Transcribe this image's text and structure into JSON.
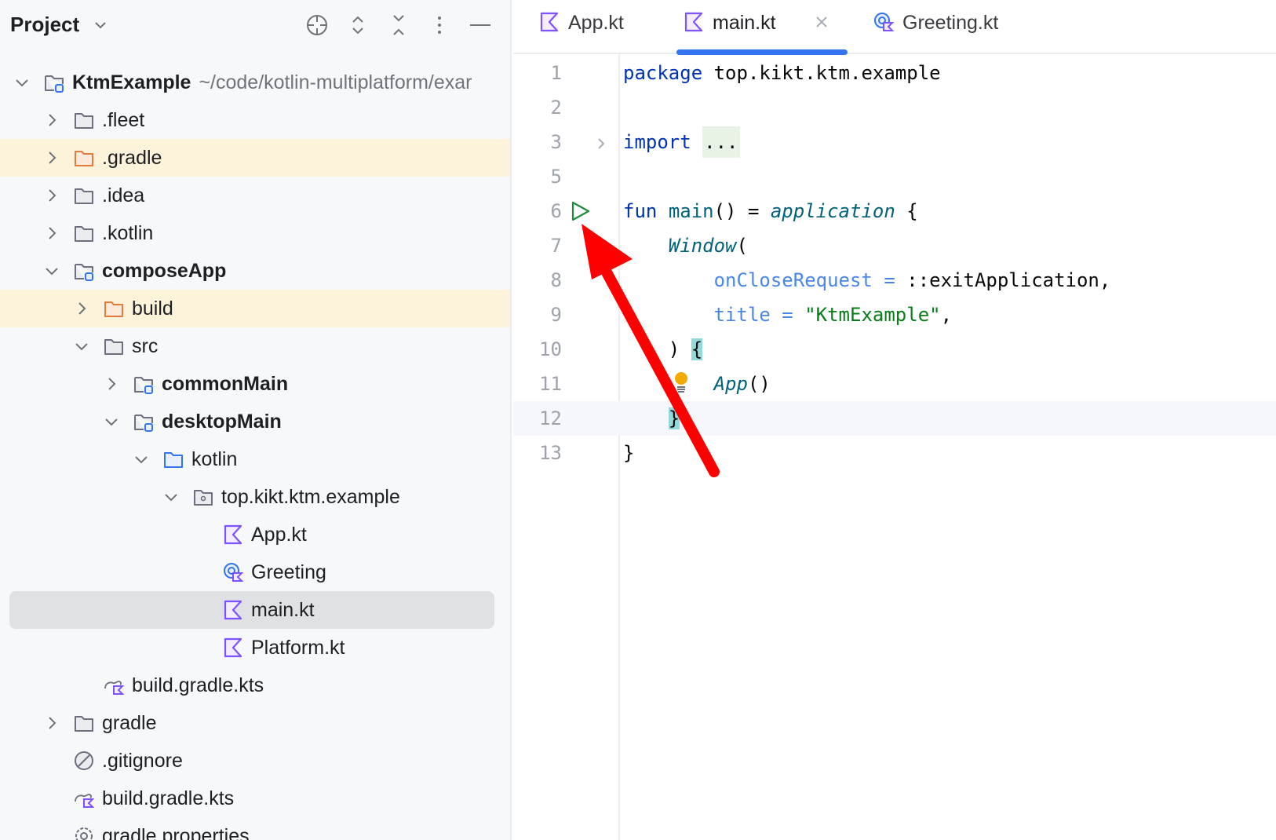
{
  "sidebar": {
    "title": "Project",
    "toolbar": [
      "locate-icon",
      "expand-all-icon",
      "collapse-all-icon",
      "more-icon",
      "hide-icon"
    ],
    "items": [
      {
        "label": "KtmExample",
        "path": "~/code/kotlin-multiplatform/exar",
        "level": 0,
        "chevron": "down",
        "icon": "module",
        "bold": true
      },
      {
        "label": ".fleet",
        "level": 1,
        "chevron": "right",
        "icon": "folder"
      },
      {
        "label": ".gradle",
        "level": 1,
        "chevron": "right",
        "icon": "folder-orange",
        "highlight": true
      },
      {
        "label": ".idea",
        "level": 1,
        "chevron": "right",
        "icon": "folder"
      },
      {
        "label": ".kotlin",
        "level": 1,
        "chevron": "right",
        "icon": "folder"
      },
      {
        "label": "composeApp",
        "level": 1,
        "chevron": "down",
        "icon": "module",
        "bold": true
      },
      {
        "label": "build",
        "level": 2,
        "chevron": "right",
        "icon": "folder-orange",
        "highlight": true
      },
      {
        "label": "src",
        "level": 2,
        "chevron": "down",
        "icon": "folder"
      },
      {
        "label": "commonMain",
        "level": 3,
        "chevron": "right",
        "icon": "module",
        "bold": true
      },
      {
        "label": "desktopMain",
        "level": 3,
        "chevron": "down",
        "icon": "module",
        "bold": true
      },
      {
        "label": "kotlin",
        "level": 4,
        "chevron": "down",
        "icon": "folder-blue"
      },
      {
        "label": "top.kikt.ktm.example",
        "level": 5,
        "chevron": "down",
        "icon": "package"
      },
      {
        "label": "App.kt",
        "level": 6,
        "icon": "kotlin"
      },
      {
        "label": "Greeting",
        "level": 6,
        "icon": "kotlin-class"
      },
      {
        "label": "main.kt",
        "level": 6,
        "icon": "kotlin",
        "selected": true
      },
      {
        "label": "Platform.kt",
        "level": 6,
        "icon": "kotlin"
      },
      {
        "label": "build.gradle.kts",
        "level": 2,
        "icon": "gradle"
      },
      {
        "label": "gradle",
        "level": 1,
        "chevron": "right",
        "icon": "folder"
      },
      {
        "label": ".gitignore",
        "level": 1,
        "icon": "ignore"
      },
      {
        "label": "build.gradle.kts",
        "level": 1,
        "icon": "gradle"
      },
      {
        "label": "gradle.properties",
        "level": 1,
        "icon": "settings"
      }
    ]
  },
  "tabs": [
    {
      "label": "App.kt",
      "icon": "kotlin",
      "active": false
    },
    {
      "label": "main.kt",
      "icon": "kotlin",
      "active": true,
      "closable": true
    },
    {
      "label": "Greeting.kt",
      "icon": "kotlin-class",
      "active": false
    }
  ],
  "code": [
    {
      "n": "1",
      "tokens": [
        [
          "package",
          "kw"
        ],
        [
          " top.kikt.ktm.example",
          ""
        ]
      ]
    },
    {
      "n": "2",
      "tokens": []
    },
    {
      "n": "3",
      "fold": true,
      "tokens": [
        [
          "import",
          "kw"
        ],
        [
          " ",
          ""
        ],
        [
          "...",
          "fold"
        ]
      ]
    },
    {
      "n": "5",
      "tokens": []
    },
    {
      "n": "6",
      "run": true,
      "tokens": [
        [
          "fun",
          "kw"
        ],
        [
          " ",
          ""
        ],
        [
          "main",
          "fn"
        ],
        [
          "() = ",
          ""
        ],
        [
          "application",
          "it"
        ],
        [
          " {",
          ""
        ]
      ]
    },
    {
      "n": "7",
      "tokens": [
        [
          "    ",
          ""
        ],
        [
          "Window",
          "it"
        ],
        [
          "(",
          ""
        ]
      ]
    },
    {
      "n": "8",
      "tokens": [
        [
          "        ",
          ""
        ],
        [
          "onCloseRequest",
          "pr"
        ],
        [
          " ",
          ""
        ],
        [
          "=",
          "pr"
        ],
        [
          " ::exitApplication,",
          ""
        ]
      ]
    },
    {
      "n": "9",
      "tokens": [
        [
          "        ",
          ""
        ],
        [
          "title",
          "pr"
        ],
        [
          " ",
          ""
        ],
        [
          "=",
          "pr"
        ],
        [
          " ",
          ""
        ],
        [
          "\"KtmExample\"",
          "st"
        ],
        [
          ",",
          ""
        ]
      ]
    },
    {
      "n": "10",
      "tokens": [
        [
          "    ) ",
          ""
        ],
        [
          "{",
          "br"
        ]
      ]
    },
    {
      "n": "11",
      "bulb": true,
      "tokens": [
        [
          "        ",
          ""
        ],
        [
          "App",
          "it"
        ],
        [
          "()",
          ""
        ]
      ]
    },
    {
      "n": "12",
      "current": true,
      "tokens": [
        [
          "    ",
          ""
        ],
        [
          "}",
          "br"
        ]
      ]
    },
    {
      "n": "13",
      "tokens": [
        [
          "}",
          ""
        ]
      ]
    }
  ],
  "colors": {
    "accent": "#3574f0",
    "annotation_arrow": "#ff0000",
    "run_icon": "#208a3c"
  }
}
